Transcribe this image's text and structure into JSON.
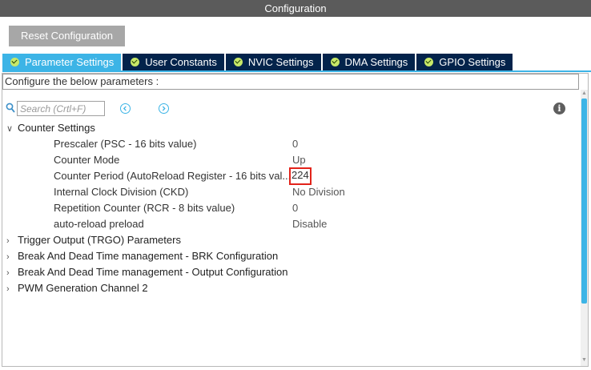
{
  "window": {
    "title": "Configuration"
  },
  "toolbar": {
    "reset_label": "Reset Configuration"
  },
  "tabs": [
    {
      "label": "Parameter Settings",
      "active": true
    },
    {
      "label": "User Constants"
    },
    {
      "label": "NVIC Settings"
    },
    {
      "label": "DMA Settings"
    },
    {
      "label": "GPIO Settings"
    }
  ],
  "hint": "Configure the below parameters :",
  "search": {
    "placeholder": "Search (Crtl+F)"
  },
  "groups": {
    "counter": {
      "label": "Counter Settings",
      "params": [
        {
          "label": "Prescaler (PSC - 16 bits value)",
          "value": "0"
        },
        {
          "label": "Counter Mode",
          "value": "Up"
        },
        {
          "label": "Counter Period (AutoReload Register - 16 bits val...",
          "value": "224"
        },
        {
          "label": "Internal Clock Division (CKD)",
          "value": "No Division"
        },
        {
          "label": "Repetition Counter (RCR - 8 bits value)",
          "value": "0"
        },
        {
          "label": "auto-reload preload",
          "value": "Disable"
        }
      ]
    },
    "collapsed": [
      {
        "label": "Trigger Output (TRGO) Parameters"
      },
      {
        "label": "Break And Dead Time management - BRK Configuration"
      },
      {
        "label": "Break And Dead Time management - Output Configuration"
      },
      {
        "label": "PWM Generation Channel 2"
      }
    ]
  },
  "colors": {
    "tab_active": "#3cb4e6",
    "tab_inactive": "#03234b",
    "highlight_border": "#e2231a",
    "title_bar": "#5b5b5b"
  }
}
